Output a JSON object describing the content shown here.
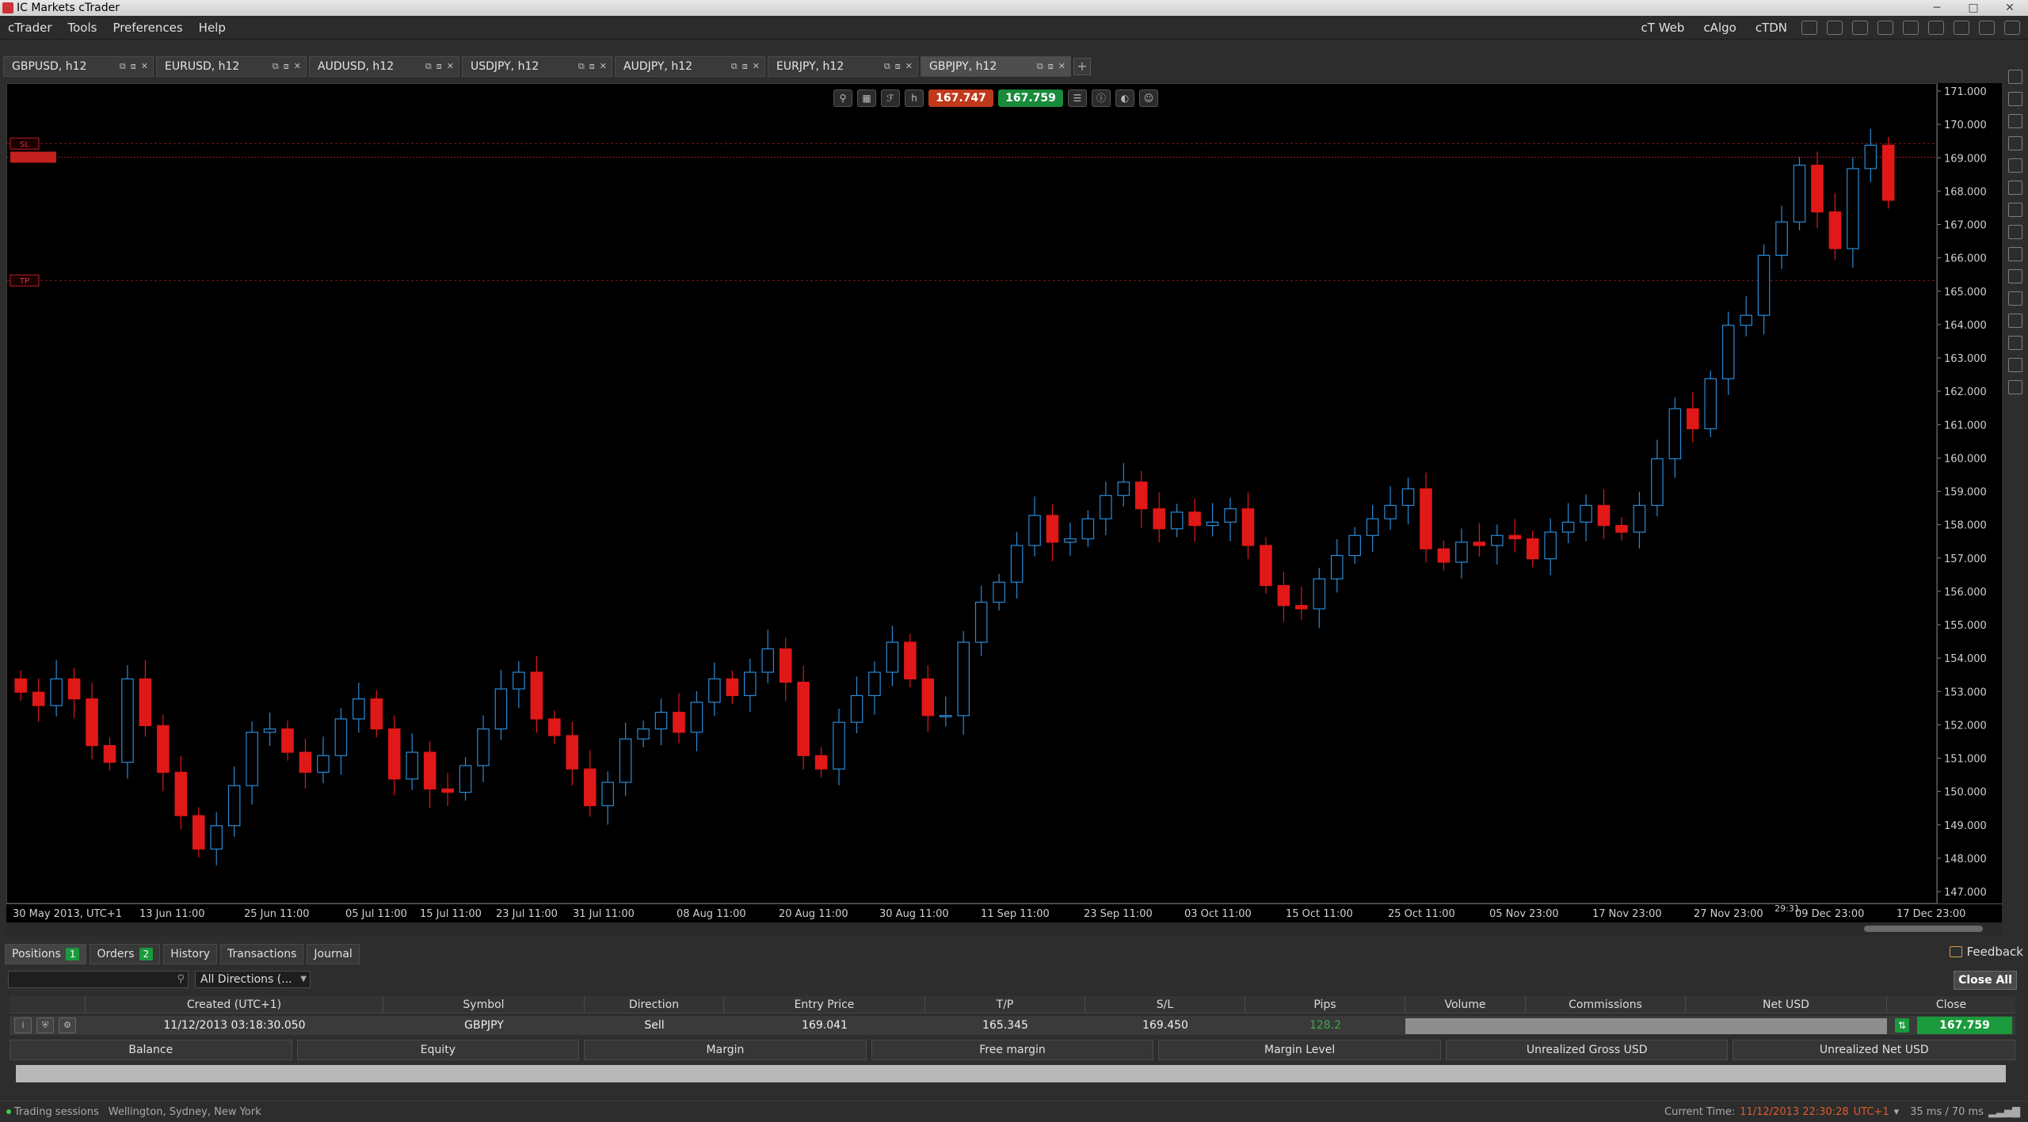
{
  "window": {
    "title": "IC Markets cTrader"
  },
  "menu": {
    "items": [
      "cTrader",
      "Tools",
      "Preferences",
      "Help"
    ],
    "right_links": [
      "cT Web",
      "cAlgo",
      "cTDN"
    ]
  },
  "tabs": [
    {
      "label": "GBPUSD, h12"
    },
    {
      "label": "EURUSD, h12"
    },
    {
      "label": "AUDUSD, h12"
    },
    {
      "label": "USDJPY, h12"
    },
    {
      "label": "AUDJPY, h12"
    },
    {
      "label": "EURJPY, h12"
    },
    {
      "label": "GBPJPY, h12",
      "active": true
    }
  ],
  "quotes": {
    "sell": "167.747",
    "buy": "167.759"
  },
  "chart_data": {
    "type": "candlestick",
    "symbol": "GBPJPY",
    "timeframe": "h12",
    "ylim": [
      147.0,
      171.0
    ],
    "y_ticks": [
      "171.000",
      "170.000",
      "169.000",
      "168.000",
      "167.000",
      "166.000",
      "165.000",
      "164.000",
      "163.000",
      "162.000",
      "161.000",
      "160.000",
      "159.000",
      "158.000",
      "157.000",
      "156.000",
      "155.000",
      "154.000",
      "153.000",
      "152.000",
      "151.000",
      "150.000",
      "149.000",
      "148.000",
      "147.000"
    ],
    "x_ticks": [
      "30 May 2013, UTC+1",
      "13 Jun 11:00",
      "25 Jun 11:00",
      "05 Jul 11:00",
      "15 Jul 11:00",
      "23 Jul 11:00",
      "31 Jul 11:00",
      "08 Aug 11:00",
      "20 Aug 11:00",
      "30 Aug 11:00",
      "11 Sep 11:00",
      "23 Sep 11:00",
      "03 Oct 11:00",
      "15 Oct 11:00",
      "25 Oct 11:00",
      "05 Nov 23:00",
      "17 Nov 23:00",
      "27 Nov 23:00",
      "09 Dec 23:00",
      "17 Dec 23:00"
    ],
    "closes": [
      153.0,
      152.6,
      153.4,
      152.8,
      151.4,
      150.9,
      153.4,
      152.0,
      150.6,
      149.3,
      148.3,
      149.0,
      150.2,
      151.8,
      151.9,
      151.2,
      150.6,
      151.1,
      152.2,
      152.8,
      151.9,
      150.4,
      151.2,
      150.1,
      150.0,
      150.8,
      151.9,
      153.1,
      153.6,
      152.2,
      151.7,
      150.7,
      149.6,
      150.3,
      151.6,
      151.9,
      152.4,
      151.8,
      152.7,
      153.4,
      152.9,
      153.6,
      154.3,
      153.3,
      151.1,
      150.7,
      152.1,
      152.9,
      153.6,
      154.5,
      153.4,
      152.3,
      152.3,
      154.5,
      155.7,
      156.3,
      157.4,
      158.3,
      157.5,
      157.6,
      158.2,
      158.9,
      159.3,
      158.5,
      157.9,
      158.4,
      158.0,
      158.1,
      158.5,
      157.4,
      156.2,
      155.6,
      155.5,
      156.4,
      157.1,
      157.7,
      158.2,
      158.6,
      159.1,
      157.3,
      156.9,
      157.5,
      157.4,
      157.7,
      157.6,
      157.0,
      157.8,
      158.1,
      158.6,
      158.0,
      157.8,
      158.6,
      160.0,
      161.5,
      160.9,
      162.4,
      164.0,
      164.3,
      166.1,
      167.1,
      168.8,
      167.4,
      166.3,
      168.7,
      169.4,
      167.75
    ],
    "open_position": {
      "tp": 165.345,
      "sl": 169.45
    },
    "countdown": "29:31"
  },
  "bottom_tabs": [
    {
      "label": "Positions",
      "badge": "1"
    },
    {
      "label": "Orders",
      "badge": "2"
    },
    {
      "label": "History"
    },
    {
      "label": "Transactions"
    },
    {
      "label": "Journal"
    }
  ],
  "feedback_label": "Feedback",
  "filter": {
    "direction": "All Directions (..."
  },
  "close_all_label": "Close All",
  "positions_table": {
    "columns": [
      "Created (UTC+1)",
      "Symbol",
      "Direction",
      "Entry Price",
      "T/P",
      "S/L",
      "Pips",
      "Volume",
      "Commissions",
      "Net USD",
      "Close"
    ],
    "rows": [
      {
        "created": "11/12/2013 03:18:30.050",
        "symbol": "GBPJPY",
        "direction": "Sell",
        "entry": "169.041",
        "tp": "165.345",
        "sl": "169.450",
        "pips": "128.2",
        "close_price": "167.759"
      }
    ]
  },
  "account": [
    "Balance",
    "Equity",
    "Margin",
    "Free margin",
    "Margin Level",
    "Unrealized Gross USD",
    "Unrealized Net USD"
  ],
  "status": {
    "sessions_label": "Trading sessions",
    "sessions_value": "Wellington, Sydney, New York",
    "current_time_label": "Current Time:",
    "current_time": "11/12/2013 22:30:28",
    "timezone": "UTC+1",
    "latency": "35 ms / 70 ms"
  }
}
